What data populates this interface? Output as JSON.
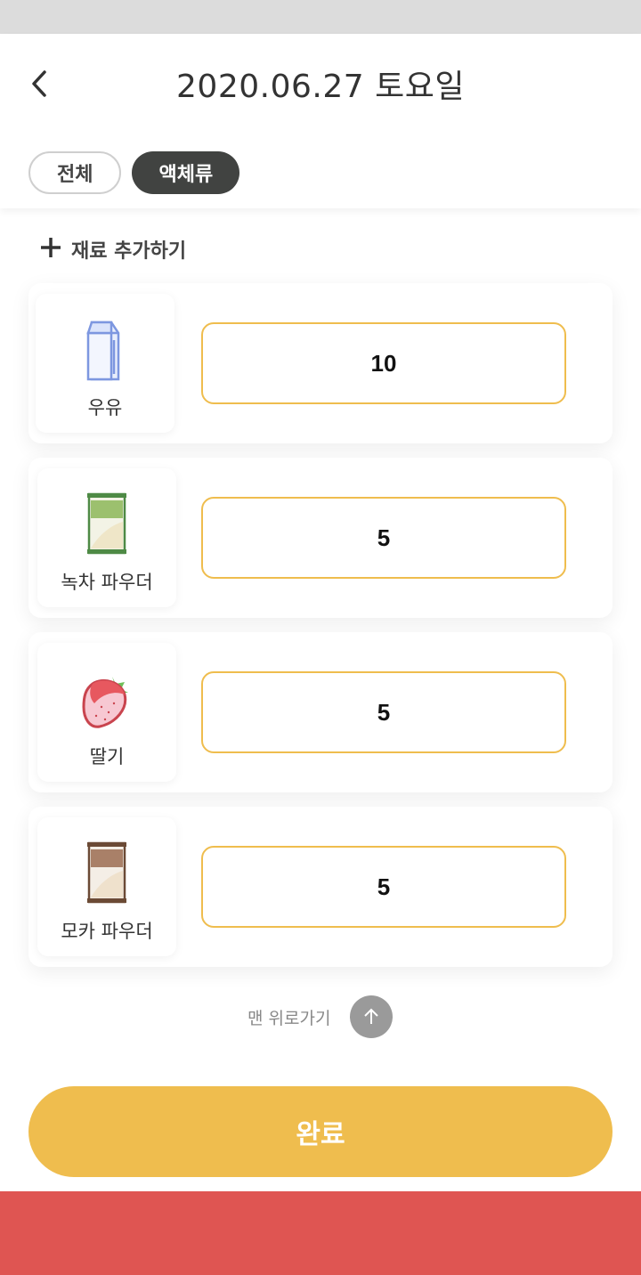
{
  "header": {
    "title": "2020.06.27 토요일",
    "back_icon": "chevron-left-icon"
  },
  "tabs": [
    {
      "label": "전체",
      "active": false
    },
    {
      "label": "액체류",
      "active": true
    }
  ],
  "add_ingredient": {
    "label": "재료 추가하기",
    "icon": "plus-icon"
  },
  "items": [
    {
      "name": "우유",
      "icon": "milk-carton-icon",
      "quantity": "10"
    },
    {
      "name": "녹차 파우더",
      "icon": "green-tea-powder-icon",
      "quantity": "5"
    },
    {
      "name": "딸기",
      "icon": "strawberry-icon",
      "quantity": "5"
    },
    {
      "name": "모카 파우더",
      "icon": "mocha-powder-icon",
      "quantity": "5"
    }
  ],
  "scroll_top": {
    "label": "맨 위로가기",
    "icon": "arrow-up-icon"
  },
  "done_button": {
    "label": "완료"
  },
  "colors": {
    "accent": "#efbd4e",
    "active_tab": "#414341",
    "bottom_bar": "#df5552"
  }
}
